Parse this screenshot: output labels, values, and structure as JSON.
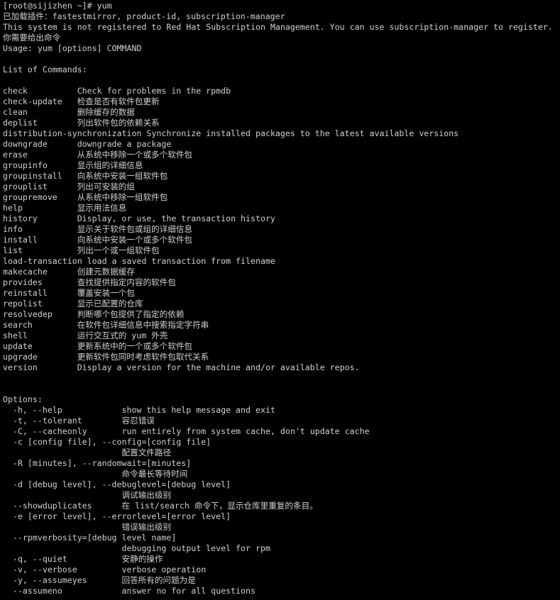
{
  "terminal": {
    "background_color": "#000000",
    "foreground_color": "#cdd1d4",
    "prompt": "[root@sijizhen ~]#",
    "command": "yum",
    "screen_text": "[root@sijizhen ~]# yum\n已加载插件：fastestmirror, product-id, subscription-manager\nThis system is not registered to Red Hat Subscription Management. You can use subscription-manager to register.\n你需要给出命令\nUsage: yum [options] COMMAND\n\nList of Commands:\n\ncheck          Check for problems in the rpmdb\ncheck-update   检查是否有软件包更新\nclean          删除缓存的数据\ndeplist        列出软件包的依赖关系\ndistribution-synchronization Synchronize installed packages to the latest available versions\ndowngrade      downgrade a package\nerase          从系统中移除一个或多个软件包\ngroupinfo      显示组的详细信息\ngroupinstall   向系统中安装一组软件包\ngrouplist      列出可安装的组\ngroupremove    从系统中移除一组软件包\nhelp           显示用法信息\nhistory        Display, or use, the transaction history\ninfo           显示关于软件包或组的详细信息\ninstall        向系统中安装一个或多个软件包\nlist           列出一个或一组软件包\nload-transaction load a saved transaction from filename\nmakecache      创建元数据缓存\nprovides       查找提供指定内容的软件包\nreinstall      覆盖安装一个包\nrepolist       显示已配置的仓库\nresolvedep     判断哪个包提供了指定的依赖\nsearch         在软件包详细信息中搜索指定字符串\nshell          运行交互式的 yum 外壳\nupdate         更新系统中的一个或多个软件包\nupgrade        更新软件包同时考虑软件包取代关系\nversion        Display a version for the machine and/or available repos.\n\n\nOptions:\n  -h, --help            show this help message and exit\n  -t, --tolerant        容忍错误\n  -C, --cacheonly       run entirely from system cache, don't update cache\n  -c [config file], --config=[config file]\n                        配置文件路径\n  -R [minutes], --randomwait=[minutes]\n                        命令最长等待时间\n  -d [debug level], --debuglevel=[debug level]\n                        调试输出级别\n  --showduplicates      在 list/search 命令下，显示仓库里重复的条目。\n  -e [error level], --errorlevel=[error level]\n                        错误输出级别\n  --rpmverbosity=[debug level name]\n                        debugging output level for rpm\n  -q, --quiet           安静的操作\n  -v, --verbose         verbose operation\n  -y, --assumeyes       回答所有的问题为是\n  --assumeno            answer no for all questions",
    "header_lines": [
      "[root@sijizhen ~]# yum",
      "已加载插件：fastestmirror, product-id, subscription-manager",
      "This system is not registered to Red Hat Subscription Management. You can use subscription-manager to register.",
      "你需要给出命令",
      "Usage: yum [options] COMMAND"
    ],
    "commands_heading": "List of Commands:",
    "commands": [
      {
        "name": "check",
        "description": "Check for problems in the rpmdb"
      },
      {
        "name": "check-update",
        "description": "检查是否有软件包更新"
      },
      {
        "name": "clean",
        "description": "删除缓存的数据"
      },
      {
        "name": "deplist",
        "description": "列出软件包的依赖关系"
      },
      {
        "name": "distribution-synchronization",
        "description": "Synchronize installed packages to the latest available versions"
      },
      {
        "name": "downgrade",
        "description": "downgrade a package"
      },
      {
        "name": "erase",
        "description": "从系统中移除一个或多个软件包"
      },
      {
        "name": "groupinfo",
        "description": "显示组的详细信息"
      },
      {
        "name": "groupinstall",
        "description": "向系统中安装一组软件包"
      },
      {
        "name": "grouplist",
        "description": "列出可安装的组"
      },
      {
        "name": "groupremove",
        "description": "从系统中移除一组软件包"
      },
      {
        "name": "help",
        "description": "显示用法信息"
      },
      {
        "name": "history",
        "description": "Display, or use, the transaction history"
      },
      {
        "name": "info",
        "description": "显示关于软件包或组的详细信息"
      },
      {
        "name": "install",
        "description": "向系统中安装一个或多个软件包"
      },
      {
        "name": "list",
        "description": "列出一个或一组软件包"
      },
      {
        "name": "load-transaction",
        "description": "load a saved transaction from filename"
      },
      {
        "name": "makecache",
        "description": "创建元数据缓存"
      },
      {
        "name": "provides",
        "description": "查找提供指定内容的软件包"
      },
      {
        "name": "reinstall",
        "description": "覆盖安装一个包"
      },
      {
        "name": "repolist",
        "description": "显示已配置的仓库"
      },
      {
        "name": "resolvedep",
        "description": "判断哪个包提供了指定的依赖"
      },
      {
        "name": "search",
        "description": "在软件包详细信息中搜索指定字符串"
      },
      {
        "name": "shell",
        "description": "运行交互式的 yum 外壳"
      },
      {
        "name": "update",
        "description": "更新系统中的一个或多个软件包"
      },
      {
        "name": "upgrade",
        "description": "更新软件包同时考虑软件包取代关系"
      },
      {
        "name": "version",
        "description": "Display a version for the machine and/or available repos."
      }
    ],
    "options_heading": "Options:",
    "options": [
      {
        "flags": "-h, --help",
        "description": "show this help message and exit"
      },
      {
        "flags": "-t, --tolerant",
        "description": "容忍错误"
      },
      {
        "flags": "-C, --cacheonly",
        "description": "run entirely from system cache, don't update cache"
      },
      {
        "flags": "-c [config file], --config=[config file]",
        "description": "配置文件路径"
      },
      {
        "flags": "-R [minutes], --randomwait=[minutes]",
        "description": "命令最长等待时间"
      },
      {
        "flags": "-d [debug level], --debuglevel=[debug level]",
        "description": "调试输出级别"
      },
      {
        "flags": "--showduplicates",
        "description": "在 list/search 命令下，显示仓库里重复的条目。"
      },
      {
        "flags": "-e [error level], --errorlevel=[error level]",
        "description": "错误输出级别"
      },
      {
        "flags": "--rpmverbosity=[debug level name]",
        "description": "debugging output level for rpm"
      },
      {
        "flags": "-q, --quiet",
        "description": "安静的操作"
      },
      {
        "flags": "-v, --verbose",
        "description": "verbose operation"
      },
      {
        "flags": "-y, --assumeyes",
        "description": "回答所有的问题为是"
      },
      {
        "flags": "--assumeno",
        "description": "answer no for all questions"
      }
    ]
  }
}
